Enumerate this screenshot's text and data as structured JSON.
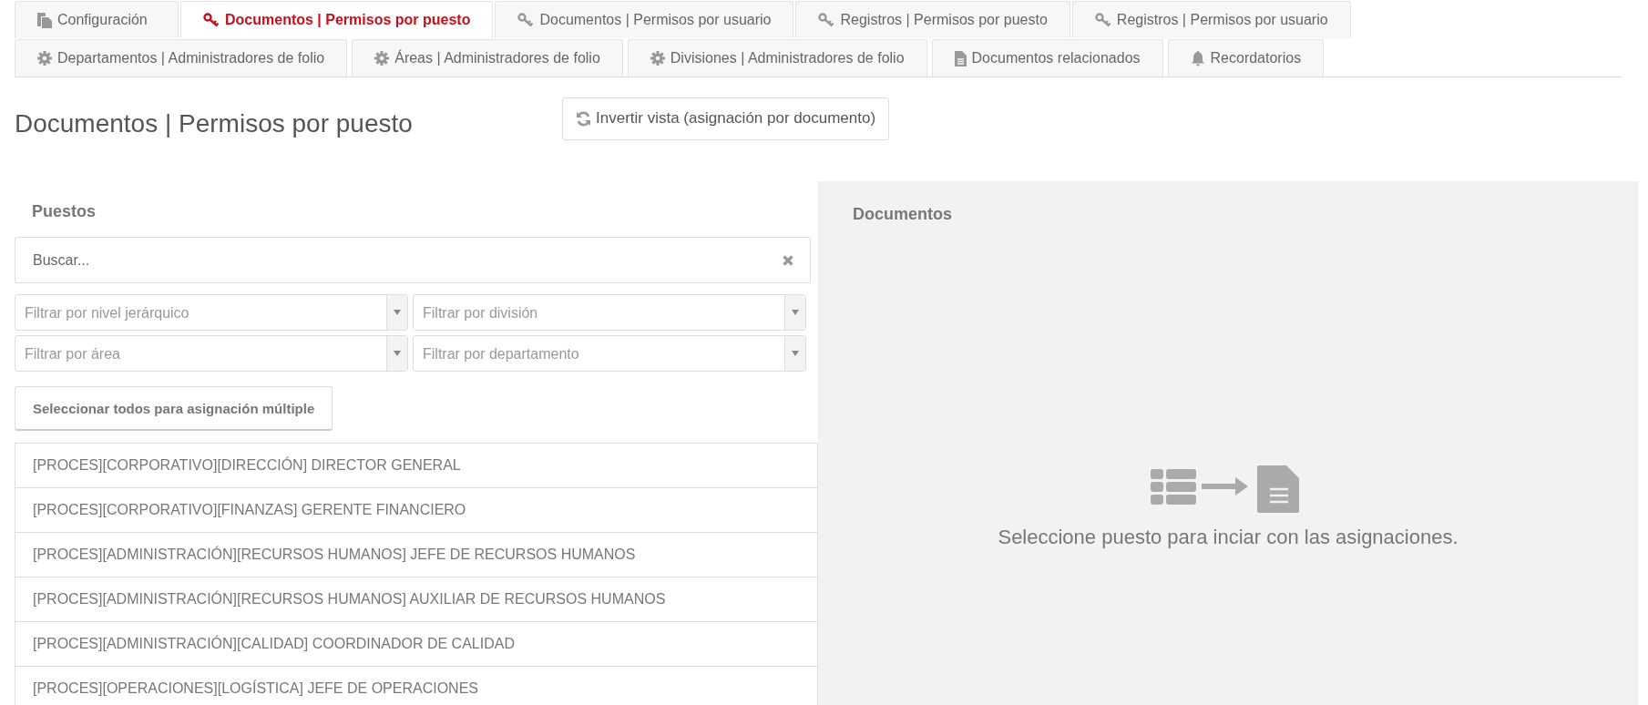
{
  "tabs": [
    [
      {
        "label": "Configuración",
        "selected": false
      },
      {
        "label": "Documentos | Permisos por puesto",
        "selected": true
      },
      {
        "label": "Documentos | Permisos por usuario",
        "selected": false
      },
      {
        "label": "Registros | Permisos por puesto",
        "selected": false
      },
      {
        "label": "Registros | Permisos por usuario",
        "selected": false
      }
    ],
    [
      {
        "label": "Departamentos | Administradores de folio",
        "selected": false
      },
      {
        "label": "Áreas | Administradores de folio",
        "selected": false
      },
      {
        "label": "Divisiones | Administradores de folio",
        "selected": false
      },
      {
        "label": "Documentos relacionados",
        "selected": false
      },
      {
        "label": "Recordatorios",
        "selected": false
      }
    ]
  ],
  "page_title": "Documentos | Permisos por puesto",
  "invert_button": "Invertir vista (asignación por documento)",
  "puestos": {
    "title": "Puestos",
    "search": {
      "placeholder": "Buscar..."
    },
    "filters": [
      {
        "placeholder": "Filtrar por nivel jerárquico"
      },
      {
        "placeholder": "Filtrar por división"
      },
      {
        "placeholder": "Filtrar por área"
      },
      {
        "placeholder": "Filtrar por departamento"
      }
    ],
    "select_all_button": "Seleccionar todos para asignación múltiple",
    "items": [
      "[PROCES][CORPORATIVO][DIRECCIÓN] DIRECTOR GENERAL",
      "[PROCES][CORPORATIVO][FINANZAS] GERENTE FINANCIERO",
      "[PROCES][ADMINISTRACIÓN][RECURSOS HUMANOS] JEFE DE RECURSOS HUMANOS",
      "[PROCES][ADMINISTRACIÓN][RECURSOS HUMANOS] AUXILIAR DE RECURSOS HUMANOS",
      "[PROCES][ADMINISTRACIÓN][CALIDAD] COORDINADOR DE CALIDAD",
      "[PROCES][OPERACIONES][LOGÍSTICA] JEFE DE OPERACIONES"
    ]
  },
  "documentos": {
    "title": "Documentos",
    "empty_message": "Seleccione puesto para inciar con las asignaciones."
  }
}
